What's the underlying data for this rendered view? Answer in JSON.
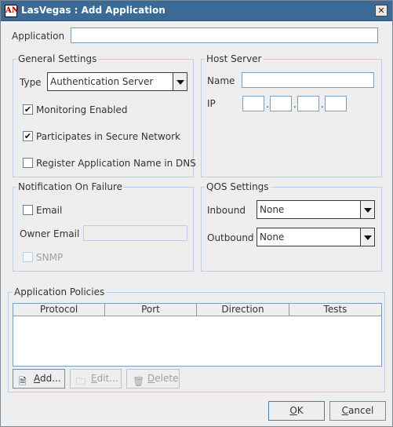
{
  "window": {
    "title": "LasVegas : Add Application",
    "icon": "AN",
    "close_glyph": "✕"
  },
  "application": {
    "label": "Application",
    "value": ""
  },
  "general_settings": {
    "title": "General Settings",
    "type_label": "Type",
    "type_value": "Authentication Server",
    "monitoring_enabled": {
      "label": "Monitoring Enabled",
      "checked": true
    },
    "secure_network": {
      "label": "Participates in Secure Network",
      "checked": true
    },
    "register_dns": {
      "label": "Register Application Name in DNS",
      "checked": false
    }
  },
  "host_server": {
    "title": "Host Server",
    "name_label": "Name",
    "name_value": "",
    "ip_label": "IP",
    "ip_octets": [
      "",
      "",
      "",
      ""
    ],
    "ip_separator": "."
  },
  "notification": {
    "title": "Notification On Failure",
    "email": {
      "label": "Email",
      "checked": false
    },
    "owner_email_label": "Owner Email",
    "owner_email_value": "",
    "snmp": {
      "label": "SNMP",
      "checked": false,
      "enabled": false
    }
  },
  "qos": {
    "title": "QOS Settings",
    "inbound_label": "Inbound",
    "inbound_value": "None",
    "outbound_label": "Outbound",
    "outbound_value": "None"
  },
  "policies": {
    "title": "Application Policies",
    "columns": [
      "Protocol",
      "Port",
      "Direction",
      "Tests"
    ],
    "rows": [],
    "add_prefix": "A",
    "add_rest": "dd...",
    "edit_prefix": "E",
    "edit_rest": "dit...",
    "delete_prefix": "D",
    "delete_rest": "elete"
  },
  "footer": {
    "ok_prefix": "O",
    "ok_rest": "K",
    "cancel_prefix": "C",
    "cancel_rest": "ancel"
  },
  "icons": {
    "add": "add-document-icon",
    "edit": "folder-edit-icon",
    "delete": "trash-icon",
    "check_glyph": "✔"
  }
}
